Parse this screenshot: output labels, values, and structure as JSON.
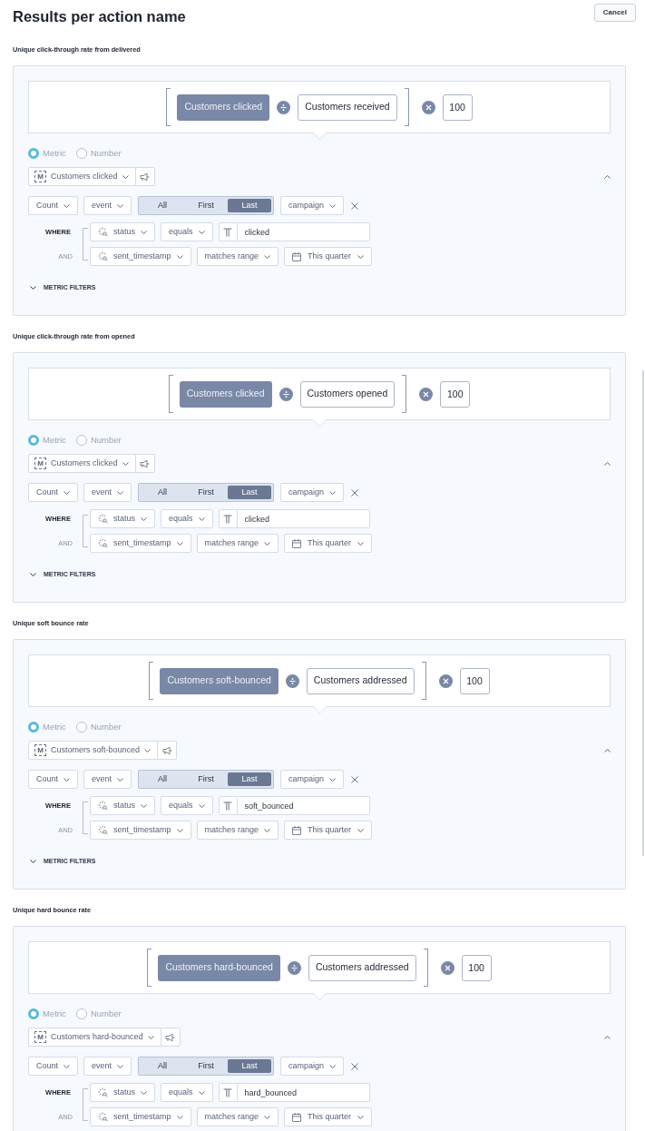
{
  "header": {
    "title": "Results per action name",
    "cancel": "Cancel"
  },
  "sections": [
    {
      "label": "Unique click-through rate from delivered",
      "formula": {
        "numerator": "Customers clicked",
        "denominator": "Customers received",
        "multiplier": "100"
      },
      "value_type": [
        {
          "label": "Metric",
          "selected": true
        },
        {
          "label": "Number",
          "selected": false
        }
      ],
      "metric": {
        "symbol": "M",
        "name": "Customers clicked"
      },
      "expanded": true,
      "aggregation": {
        "function": "Count",
        "source": "event",
        "occurrence": [
          {
            "label": "All",
            "selected": false
          },
          {
            "label": "First",
            "selected": false
          },
          {
            "label": "Last",
            "selected": true
          }
        ],
        "group_by": "campaign"
      },
      "conditions": [
        {
          "connector": "WHERE",
          "field": "status",
          "operator": "equals",
          "kind": "text",
          "value": "clicked"
        },
        {
          "connector": "AND",
          "field": "sent_timestamp",
          "operator": "matches range",
          "kind": "date",
          "value": "This quarter"
        }
      ],
      "metric_filters": "METRIC FILTERS"
    },
    {
      "label": "Unique click-through rate from opened",
      "formula": {
        "numerator": "Customers clicked",
        "denominator": "Customers opened",
        "multiplier": "100"
      },
      "value_type": [
        {
          "label": "Metric",
          "selected": true
        },
        {
          "label": "Number",
          "selected": false
        }
      ],
      "metric": {
        "symbol": "M",
        "name": "Customers clicked"
      },
      "expanded": true,
      "aggregation": {
        "function": "Count",
        "source": "event",
        "occurrence": [
          {
            "label": "All",
            "selected": false
          },
          {
            "label": "First",
            "selected": false
          },
          {
            "label": "Last",
            "selected": true
          }
        ],
        "group_by": "campaign"
      },
      "conditions": [
        {
          "connector": "WHERE",
          "field": "status",
          "operator": "equals",
          "kind": "text",
          "value": "clicked"
        },
        {
          "connector": "AND",
          "field": "sent_timestamp",
          "operator": "matches range",
          "kind": "date",
          "value": "This quarter"
        }
      ],
      "metric_filters": "METRIC FILTERS"
    },
    {
      "label": "Unique soft bounce rate",
      "formula": {
        "numerator": "Customers soft-bounced",
        "denominator": "Customers addressed",
        "multiplier": "100"
      },
      "value_type": [
        {
          "label": "Metric",
          "selected": true
        },
        {
          "label": "Number",
          "selected": false
        }
      ],
      "metric": {
        "symbol": "M",
        "name": "Customers soft-bounced"
      },
      "expanded": true,
      "aggregation": {
        "function": "Count",
        "source": "event",
        "occurrence": [
          {
            "label": "All",
            "selected": false
          },
          {
            "label": "First",
            "selected": false
          },
          {
            "label": "Last",
            "selected": true
          }
        ],
        "group_by": "campaign"
      },
      "conditions": [
        {
          "connector": "WHERE",
          "field": "status",
          "operator": "equals",
          "kind": "text",
          "value": "soft_bounced"
        },
        {
          "connector": "AND",
          "field": "sent_timestamp",
          "operator": "matches range",
          "kind": "date",
          "value": "This quarter"
        }
      ],
      "metric_filters": "METRIC FILTERS"
    },
    {
      "label": "Unique hard bounce rate",
      "formula": {
        "numerator": "Customers hard-bounced",
        "denominator": "Customers addressed",
        "multiplier": "100"
      },
      "value_type": [
        {
          "label": "Metric",
          "selected": true
        },
        {
          "label": "Number",
          "selected": false
        }
      ],
      "metric": {
        "symbol": "M",
        "name": "Customers hard-bounced"
      },
      "expanded": true,
      "aggregation": {
        "function": "Count",
        "source": "event",
        "occurrence": [
          {
            "label": "All",
            "selected": false
          },
          {
            "label": "First",
            "selected": false
          },
          {
            "label": "Last",
            "selected": true
          }
        ],
        "group_by": "campaign"
      },
      "conditions": [
        {
          "connector": "WHERE",
          "field": "status",
          "operator": "equals",
          "kind": "text",
          "value": "hard_bounced"
        },
        {
          "connector": "AND",
          "field": "sent_timestamp",
          "operator": "matches range",
          "kind": "date",
          "value": "This quarter"
        }
      ]
    }
  ]
}
